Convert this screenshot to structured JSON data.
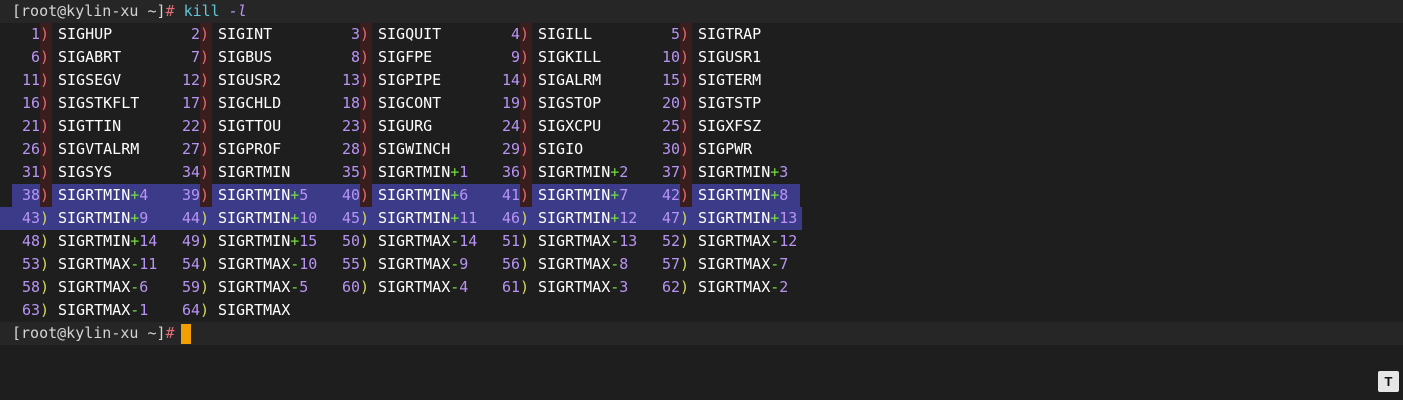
{
  "prompt": {
    "user_host": "[root@kylin-xu ~]",
    "symbol": "#"
  },
  "command": {
    "name": "kill",
    "flag": "-l"
  },
  "signals": [
    [
      [
        "1",
        "SIGHUP"
      ],
      [
        "2",
        "SIGINT"
      ],
      [
        "3",
        "SIGQUIT"
      ],
      [
        "4",
        "SIGILL"
      ],
      [
        "5",
        "SIGTRAP"
      ]
    ],
    [
      [
        "6",
        "SIGABRT"
      ],
      [
        "7",
        "SIGBUS"
      ],
      [
        "8",
        "SIGFPE"
      ],
      [
        "9",
        "SIGKILL"
      ],
      [
        "10",
        "SIGUSR1"
      ]
    ],
    [
      [
        "11",
        "SIGSEGV"
      ],
      [
        "12",
        "SIGUSR2"
      ],
      [
        "13",
        "SIGPIPE"
      ],
      [
        "14",
        "SIGALRM"
      ],
      [
        "15",
        "SIGTERM"
      ]
    ],
    [
      [
        "16",
        "SIGSTKFLT"
      ],
      [
        "17",
        "SIGCHLD"
      ],
      [
        "18",
        "SIGCONT"
      ],
      [
        "19",
        "SIGSTOP"
      ],
      [
        "20",
        "SIGTSTP"
      ]
    ],
    [
      [
        "21",
        "SIGTTIN"
      ],
      [
        "22",
        "SIGTTOU"
      ],
      [
        "23",
        "SIGURG"
      ],
      [
        "24",
        "SIGXCPU"
      ],
      [
        "25",
        "SIGXFSZ"
      ]
    ],
    [
      [
        "26",
        "SIGVTALRM"
      ],
      [
        "27",
        "SIGPROF"
      ],
      [
        "28",
        "SIGWINCH"
      ],
      [
        "29",
        "SIGIO"
      ],
      [
        "30",
        "SIGPWR"
      ]
    ],
    [
      [
        "31",
        "SIGSYS"
      ],
      [
        "34",
        "SIGRTMIN"
      ],
      [
        "35",
        "SIGRTMIN+1"
      ],
      [
        "36",
        "SIGRTMIN+2"
      ],
      [
        "37",
        "SIGRTMIN+3"
      ]
    ],
    [
      [
        "38",
        "SIGRTMIN+4"
      ],
      [
        "39",
        "SIGRTMIN+5"
      ],
      [
        "40",
        "SIGRTMIN+6"
      ],
      [
        "41",
        "SIGRTMIN+7"
      ],
      [
        "42",
        "SIGRTMIN+8"
      ]
    ],
    [
      [
        "43",
        "SIGRTMIN+9"
      ],
      [
        "44",
        "SIGRTMIN+10"
      ],
      [
        "45",
        "SIGRTMIN+11"
      ],
      [
        "46",
        "SIGRTMIN+12"
      ],
      [
        "47",
        "SIGRTMIN+13"
      ]
    ],
    [
      [
        "48",
        "SIGRTMIN+14"
      ],
      [
        "49",
        "SIGRTMIN+15"
      ],
      [
        "50",
        "SIGRTMAX-14"
      ],
      [
        "51",
        "SIGRTMAX-13"
      ],
      [
        "52",
        "SIGRTMAX-12"
      ]
    ],
    [
      [
        "53",
        "SIGRTMAX-11"
      ],
      [
        "54",
        "SIGRTMAX-10"
      ],
      [
        "55",
        "SIGRTMAX-9"
      ],
      [
        "56",
        "SIGRTMAX-8"
      ],
      [
        "57",
        "SIGRTMAX-7"
      ]
    ],
    [
      [
        "58",
        "SIGRTMAX-6"
      ],
      [
        "59",
        "SIGRTMAX-5"
      ],
      [
        "60",
        "SIGRTMAX-4"
      ],
      [
        "61",
        "SIGRTMAX-3"
      ],
      [
        "62",
        "SIGRTMAX-2"
      ]
    ],
    [
      [
        "63",
        "SIGRTMAX-1"
      ],
      [
        "64",
        "SIGRTMAX"
      ]
    ]
  ],
  "badge": "T",
  "colors": {
    "background": "#1e1e1e",
    "selection": "#3b3b8a",
    "number": "#b994f5",
    "name": "#ffffff",
    "plus_minus": "#77dd44",
    "cursor": "#f0a000",
    "command": "#5fc6d6"
  }
}
